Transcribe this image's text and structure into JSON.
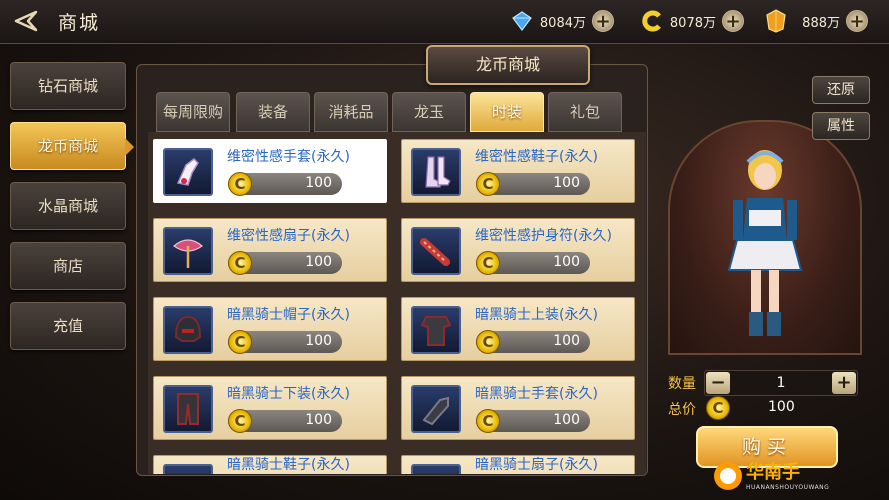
{
  "header": {
    "title": "商城",
    "currencies": [
      {
        "icon": "diamond-icon",
        "value": "8084万"
      },
      {
        "icon": "dragon-coin-icon",
        "value": "8078万"
      },
      {
        "icon": "crystal-icon",
        "value": "888万"
      }
    ]
  },
  "sidebar": {
    "items": [
      {
        "label": "钻石商城",
        "active": false
      },
      {
        "label": "龙币商城",
        "active": true
      },
      {
        "label": "水晶商城",
        "active": false
      },
      {
        "label": "商店",
        "active": false
      },
      {
        "label": "充值",
        "active": false
      }
    ]
  },
  "panel": {
    "title": "龙币商城",
    "tabs": [
      {
        "label": "每周限购",
        "active": false
      },
      {
        "label": "装备",
        "active": false
      },
      {
        "label": "消耗品",
        "active": false
      },
      {
        "label": "龙玉",
        "active": false
      },
      {
        "label": "时装",
        "active": true
      },
      {
        "label": "礼包",
        "active": false
      }
    ],
    "items": [
      {
        "name": "维密性感手套(永久)",
        "price": "100",
        "icon": "glove-icon",
        "selected": true
      },
      {
        "name": "维密性感鞋子(永久)",
        "price": "100",
        "icon": "boots-icon",
        "selected": false
      },
      {
        "name": "维密性感扇子(永久)",
        "price": "100",
        "icon": "fan-icon",
        "selected": false
      },
      {
        "name": "维密性感护身符(永久)",
        "price": "100",
        "icon": "amulet-icon",
        "selected": false
      },
      {
        "name": "暗黑骑士帽子(永久)",
        "price": "100",
        "icon": "helmet-icon",
        "selected": false
      },
      {
        "name": "暗黑骑士上装(永久)",
        "price": "100",
        "icon": "armor-icon",
        "selected": false
      },
      {
        "name": "暗黑骑士下装(永久)",
        "price": "100",
        "icon": "pants-icon",
        "selected": false
      },
      {
        "name": "暗黑骑士手套(永久)",
        "price": "100",
        "icon": "gauntlet-icon",
        "selected": false
      },
      {
        "name": "暗黑骑士鞋子(永久)",
        "price": "",
        "icon": "boots-icon",
        "selected": false
      },
      {
        "name": "暗黑骑士扇子(永久)",
        "price": "",
        "icon": "fan-icon",
        "selected": false
      }
    ]
  },
  "preview": {
    "restore_label": "还原",
    "attributes_label": "属性",
    "quantity_label": "数量",
    "quantity_value": "1",
    "total_label": "总价",
    "total_value": "100",
    "buy_label": "购买"
  },
  "watermark": {
    "text": "华南手",
    "subtext": "HUANANSHOUYOUWANG"
  }
}
